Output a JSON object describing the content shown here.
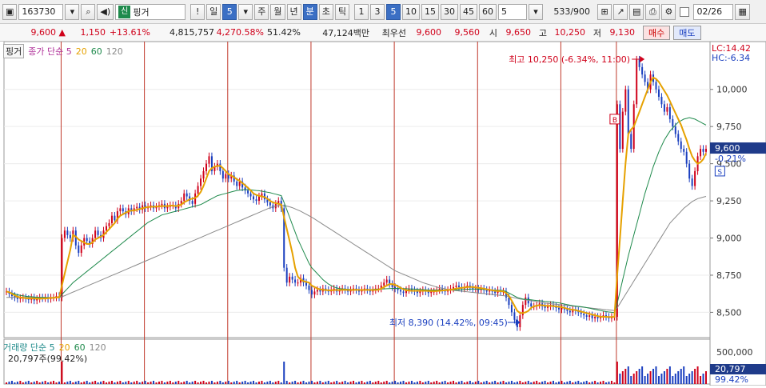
{
  "toolbar": {
    "code": "163730",
    "market_badge": "신",
    "name": "핑거",
    "warning": "!",
    "period_tabs": [
      "일",
      "주",
      "월",
      "년",
      "분",
      "초",
      "틱"
    ],
    "period_value": "5",
    "minute_opts": [
      "1",
      "3",
      "5",
      "10",
      "15",
      "30",
      "45",
      "60"
    ],
    "custom_value": "5",
    "count": "533",
    "count_total": "/900",
    "date": "02/26"
  },
  "quote": {
    "price": "9,600",
    "change": "1,150",
    "change_pct": "+13.61%",
    "volume": "4,815,757",
    "volume_ratio": "4,270.58%",
    "turnover_ratio": "51.42%",
    "amount": "47,124백만",
    "priority_label": "최우선",
    "ask": "9,600",
    "bid": "9,560",
    "open_label": "시",
    "open": "9,650",
    "high_label": "고",
    "high": "10,250",
    "low_label": "저",
    "low": "9,130",
    "buy_label": "매수",
    "sell_label": "매도"
  },
  "legend": {
    "item": "핑거",
    "ma_label": "종가 단순 5",
    "ma_periods": [
      "20",
      "60",
      "120"
    ]
  },
  "vol_legend": {
    "label": "거래량 단순 5",
    "ma_periods": [
      "20",
      "60",
      "120"
    ],
    "current": "20,797주(99.42%)"
  },
  "annotations": {
    "high": "최고 10,250 (-6.34%, 11:00)",
    "low": "최저 8,390 (14.42%, 09:45)",
    "lc": "LC:14.42",
    "hc": "HC:-6.34",
    "price_tag": "9,600",
    "price_tag_pct": "-0.21%",
    "vol_tag": "20,797",
    "vol_tag_pct": "99.42%",
    "buy_marker": "B",
    "sell_marker": "S"
  },
  "colors": {
    "up": "#d0021b",
    "down": "#1a3fbf",
    "ma5": "#e6a100",
    "ma20": "#1f8a4c",
    "ma60": "#8a8a8a",
    "session_line": "#c0392b"
  },
  "chart_data": {
    "type": "line",
    "price_axis_ticks": [
      "10,000",
      "9,750",
      "9,500",
      "9,250",
      "9,000",
      "8,750",
      "8,500"
    ],
    "volume_axis_ticks": [
      "500,000"
    ],
    "ylim": [
      8330,
      10300
    ],
    "price_series": [
      8640,
      8625,
      8610,
      8600,
      8590,
      8595,
      8600,
      8590,
      8585,
      8600,
      8580,
      8590,
      8600,
      8595,
      8600,
      8590,
      8600,
      8600,
      8610,
      8600,
      9000,
      9050,
      9020,
      9000,
      9050,
      8950,
      8900,
      8950,
      9000,
      8980,
      8960,
      9000,
      9050,
      9020,
      9000,
      9050,
      9080,
      9100,
      9150,
      9120,
      9180,
      9200,
      9180,
      9160,
      9200,
      9180,
      9200,
      9210,
      9190,
      9220,
      9200,
      9210,
      9220,
      9200,
      9210,
      9220,
      9230,
      9200,
      9210,
      9220,
      9220,
      9200,
      9230,
      9250,
      9300,
      9280,
      9250,
      9230,
      9300,
      9350,
      9400,
      9450,
      9500,
      9550,
      9450,
      9480,
      9500,
      9450,
      9400,
      9430,
      9400,
      9420,
      9380,
      9350,
      9380,
      9340,
      9320,
      9300,
      9280,
      9260,
      9250,
      9280,
      9300,
      9260,
      9240,
      9220,
      9200,
      9230,
      9250,
      9200,
      8800,
      8700,
      8740,
      8720,
      8700,
      8700,
      8730,
      8700,
      8680,
      8650,
      8620,
      8640,
      8650,
      8640,
      8660,
      8650,
      8640,
      8650,
      8660,
      8640,
      8650,
      8660,
      8650,
      8640,
      8650,
      8660,
      8650,
      8640,
      8650,
      8660,
      8650,
      8640,
      8650,
      8660,
      8660,
      8680,
      8700,
      8720,
      8690,
      8670,
      8660,
      8650,
      8640,
      8630,
      8650,
      8660,
      8650,
      8640,
      8630,
      8640,
      8650,
      8640,
      8630,
      8640,
      8640,
      8650,
      8660,
      8650,
      8640,
      8650,
      8660,
      8670,
      8680,
      8670,
      8660,
      8670,
      8680,
      8670,
      8660,
      8660,
      8650,
      8660,
      8650,
      8640,
      8650,
      8640,
      8630,
      8650,
      8640,
      8640,
      8600,
      8550,
      8500,
      8450,
      8400,
      8480,
      8550,
      8600,
      8560,
      8540,
      8540,
      8550,
      8560,
      8540,
      8530,
      8540,
      8550,
      8540,
      8530,
      8520,
      8530,
      8520,
      8510,
      8500,
      8520,
      8510,
      8500,
      8490,
      8480,
      8470,
      8480,
      8460,
      8470,
      8460,
      8470,
      8480,
      8470,
      8460,
      8470,
      8470,
      9900,
      9600,
      9850,
      10000,
      9700,
      9600,
      9900,
      10200,
      10150,
      10100,
      10050,
      10000,
      10100,
      10050,
      10000,
      9950,
      9900,
      9850,
      9880,
      9800,
      9750,
      9700,
      9650,
      9600,
      9580,
      9500,
      9400,
      9350,
      9450,
      9550,
      9600,
      9580,
      9600
    ],
    "ma5": [
      8640,
      8635,
      8625,
      8615,
      8605,
      8600,
      8598,
      8595,
      8594,
      8596,
      8592,
      8593,
      8591,
      8593,
      8593,
      8595,
      8597,
      8597,
      8600,
      8600,
      8680,
      8760,
      8840,
      8920,
      9020,
      9010,
      8990,
      8980,
      8970,
      8960,
      8960,
      8970,
      8990,
      9000,
      9010,
      9020,
      9040,
      9060,
      9080,
      9100,
      9130,
      9150,
      9160,
      9170,
      9180,
      9185,
      9185,
      9190,
      9195,
      9200,
      9205,
      9208,
      9210,
      9210,
      9212,
      9213,
      9215,
      9215,
      9215,
      9218,
      9218,
      9215,
      9218,
      9225,
      9240,
      9250,
      9260,
      9265,
      9270,
      9285,
      9310,
      9350,
      9400,
      9450,
      9470,
      9480,
      9485,
      9486,
      9470,
      9450,
      9430,
      9420,
      9410,
      9395,
      9385,
      9370,
      9355,
      9338,
      9320,
      9300,
      9290,
      9283,
      9280,
      9275,
      9265,
      9250,
      9240,
      9235,
      9230,
      9225,
      9140,
      9060,
      8980,
      8900,
      8800,
      8740,
      8720,
      8710,
      8705,
      8700,
      8680,
      8670,
      8660,
      8655,
      8652,
      8650,
      8648,
      8648,
      8650,
      8650,
      8650,
      8651,
      8652,
      8650,
      8650,
      8651,
      8652,
      8651,
      8650,
      8651,
      8651,
      8650,
      8650,
      8651,
      8652,
      8660,
      8670,
      8680,
      8690,
      8690,
      8685,
      8675,
      8665,
      8655,
      8648,
      8646,
      8645,
      8645,
      8645,
      8645,
      8645,
      8645,
      8643,
      8643,
      8642,
      8643,
      8645,
      8647,
      8648,
      8650,
      8652,
      8655,
      8660,
      8662,
      8665,
      8667,
      8670,
      8670,
      8670,
      8668,
      8665,
      8662,
      8660,
      8655,
      8652,
      8648,
      8645,
      8643,
      8642,
      8641,
      8630,
      8610,
      8580,
      8545,
      8510,
      8495,
      8495,
      8500,
      8510,
      8530,
      8540,
      8545,
      8548,
      8548,
      8545,
      8543,
      8543,
      8542,
      8540,
      8537,
      8535,
      8530,
      8525,
      8520,
      8518,
      8515,
      8510,
      8505,
      8500,
      8495,
      8490,
      8485,
      8480,
      8475,
      8470,
      8470,
      8470,
      8469,
      8469,
      8470,
      8750,
      9000,
      9250,
      9500,
      9700,
      9730,
      9750,
      9800,
      9850,
      9900,
      9950,
      10000,
      10050,
      10080,
      10070,
      10050,
      10020,
      9990,
      9960,
      9920,
      9880,
      9840,
      9800,
      9760,
      9710,
      9660,
      9600,
      9550,
      9520,
      9500,
      9510,
      9530,
      9570
    ],
    "ma20": [
      8640,
      8636,
      8630,
      8624,
      8618,
      8614,
      8611,
      8608,
      8606,
      8605,
      8603,
      8602,
      8601,
      8600,
      8600,
      8599,
      8599,
      8599,
      8599,
      8599,
      8620,
      8640,
      8660,
      8680,
      8700,
      8715,
      8730,
      8745,
      8760,
      8775,
      8790,
      8805,
      8820,
      8835,
      8850,
      8865,
      8880,
      8895,
      8910,
      8925,
      8940,
      8955,
      8970,
      8985,
      9000,
      9015,
      9030,
      9045,
      9060,
      9075,
      9090,
      9105,
      9115,
      9125,
      9135,
      9145,
      9155,
      9160,
      9165,
      9170,
      9175,
      9180,
      9185,
      9190,
      9195,
      9200,
      9205,
      9210,
      9215,
      9220,
      9225,
      9235,
      9245,
      9255,
      9265,
      9275,
      9285,
      9290,
      9295,
      9300,
      9305,
      9310,
      9315,
      9320,
      9322,
      9324,
      9325,
      9325,
      9324,
      9322,
      9320,
      9318,
      9315,
      9312,
      9308,
      9305,
      9300,
      9295,
      9290,
      9285,
      9240,
      9190,
      9140,
      9090,
      9040,
      8990,
      8950,
      8910,
      8870,
      8830,
      8800,
      8780,
      8760,
      8740,
      8720,
      8705,
      8690,
      8680,
      8670,
      8665,
      8660,
      8658,
      8656,
      8655,
      8654,
      8653,
      8652,
      8652,
      8652,
      8652,
      8652,
      8653,
      8654,
      8655,
      8656,
      8657,
      8658,
      8659,
      8660,
      8661,
      8661,
      8661,
      8660,
      8660,
      8659,
      8658,
      8657,
      8656,
      8655,
      8654,
      8653,
      8652,
      8651,
      8650,
      8650,
      8650,
      8650,
      8650,
      8650,
      8650,
      8650,
      8650,
      8651,
      8652,
      8653,
      8654,
      8655,
      8656,
      8656,
      8656,
      8656,
      8655,
      8654,
      8653,
      8652,
      8651,
      8650,
      8649,
      8648,
      8647,
      8640,
      8630,
      8620,
      8610,
      8600,
      8595,
      8590,
      8588,
      8586,
      8584,
      8582,
      8580,
      8578,
      8576,
      8574,
      8572,
      8570,
      8568,
      8566,
      8564,
      8560,
      8556,
      8552,
      8548,
      8545,
      8542,
      8540,
      8538,
      8535,
      8532,
      8528,
      8524,
      8520,
      8516,
      8512,
      8508,
      8505,
      8502,
      8500,
      8498,
      8560,
      8640,
      8720,
      8800,
      8880,
      8950,
      9020,
      9090,
      9160,
      9230,
      9300,
      9360,
      9420,
      9480,
      9530,
      9580,
      9620,
      9660,
      9690,
      9720,
      9740,
      9760,
      9780,
      9790,
      9800,
      9805,
      9810,
      9805,
      9800,
      9790,
      9780,
      9770,
      9760
    ],
    "ma60": [
      8600,
      8600,
      8600,
      8600,
      8600,
      8600,
      8600,
      8600,
      8600,
      8600,
      8600,
      8600,
      8600,
      8600,
      8600,
      8600,
      8600,
      8600,
      8600,
      8600,
      8605,
      8612,
      8620,
      8628,
      8636,
      8644,
      8652,
      8660,
      8668,
      8676,
      8684,
      8692,
      8700,
      8708,
      8716,
      8724,
      8732,
      8740,
      8748,
      8756,
      8764,
      8772,
      8780,
      8788,
      8796,
      8804,
      8812,
      8820,
      8828,
      8836,
      8844,
      8852,
      8860,
      8868,
      8876,
      8884,
      8892,
      8900,
      8908,
      8916,
      8924,
      8932,
      8940,
      8948,
      8956,
      8964,
      8972,
      8980,
      8988,
      8996,
      9004,
      9012,
      9020,
      9028,
      9036,
      9044,
      9052,
      9060,
      9068,
      9076,
      9084,
      9092,
      9100,
      9108,
      9116,
      9124,
      9132,
      9140,
      9148,
      9156,
      9164,
      9172,
      9180,
      9188,
      9196,
      9204,
      9210,
      9215,
      9218,
      9220,
      9218,
      9215,
      9210,
      9204,
      9196,
      9188,
      9180,
      9170,
      9160,
      9150,
      9140,
      9128,
      9116,
      9104,
      9092,
      9080,
      9068,
      9056,
      9044,
      9032,
      9020,
      9008,
      8996,
      8984,
      8972,
      8960,
      8948,
      8936,
      8924,
      8912,
      8900,
      8888,
      8876,
      8864,
      8852,
      8840,
      8828,
      8816,
      8804,
      8792,
      8780,
      8772,
      8764,
      8756,
      8748,
      8740,
      8732,
      8724,
      8716,
      8708,
      8700,
      8694,
      8688,
      8682,
      8676,
      8670,
      8666,
      8662,
      8658,
      8654,
      8650,
      8648,
      8646,
      8644,
      8642,
      8640,
      8638,
      8636,
      8634,
      8632,
      8630,
      8628,
      8626,
      8624,
      8622,
      8620,
      8618,
      8616,
      8614,
      8612,
      8610,
      8606,
      8602,
      8598,
      8594,
      8590,
      8587,
      8584,
      8581,
      8578,
      8575,
      8572,
      8569,
      8566,
      8563,
      8560,
      8558,
      8556,
      8554,
      8552,
      8550,
      8548,
      8546,
      8544,
      8542,
      8540,
      8538,
      8536,
      8534,
      8532,
      8530,
      8528,
      8526,
      8524,
      8522,
      8520,
      8518,
      8516,
      8514,
      8512,
      8530,
      8560,
      8590,
      8620,
      8650,
      8680,
      8710,
      8740,
      8770,
      8800,
      8830,
      8860,
      8890,
      8920,
      8950,
      8980,
      9010,
      9040,
      9070,
      9100,
      9120,
      9140,
      9160,
      9180,
      9200,
      9215,
      9230,
      9245,
      9255,
      9265,
      9270,
      9275,
      9280
    ]
  }
}
